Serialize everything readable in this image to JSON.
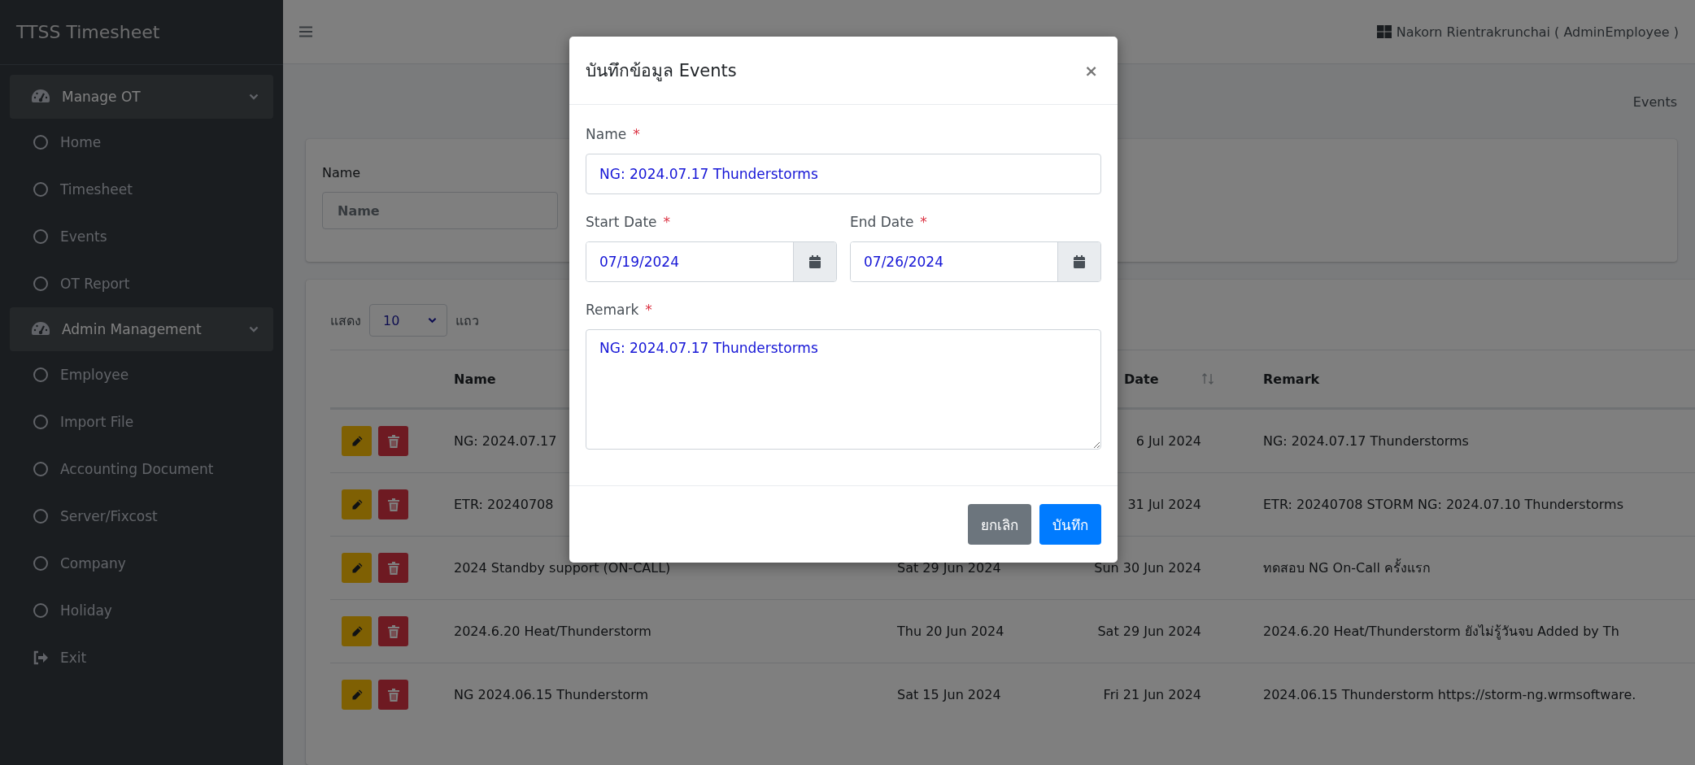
{
  "sidebar": {
    "brand": "TTSS Timesheet",
    "groups": [
      {
        "label": "Manage OT",
        "expanded": true,
        "items": [
          {
            "label": "Home",
            "kind": "circle"
          },
          {
            "label": "Timesheet",
            "kind": "circle"
          },
          {
            "label": "Events",
            "kind": "circle"
          },
          {
            "label": "OT Report",
            "kind": "circle"
          }
        ]
      },
      {
        "label": "Admin Management",
        "expanded": true,
        "items": [
          {
            "label": "Employee",
            "kind": "circle"
          },
          {
            "label": "Import File",
            "kind": "circle"
          },
          {
            "label": "Accounting Document",
            "kind": "circle"
          },
          {
            "label": "Server/Fixcost",
            "kind": "circle"
          },
          {
            "label": "Company",
            "kind": "circle"
          },
          {
            "label": "Holiday",
            "kind": "circle"
          },
          {
            "label": "Exit",
            "kind": "exit"
          }
        ]
      }
    ]
  },
  "topbar": {
    "user": "Nakorn Rientrakrunchai ( AdminEmployee )"
  },
  "breadcrumb": "Events",
  "filter": {
    "label": "Name",
    "placeholder": "Name"
  },
  "table": {
    "length": {
      "prefix": "แสดง",
      "value": "10",
      "suffix": "แถว"
    },
    "columns": [
      {
        "label": "Name"
      },
      {
        "label": "Date",
        "sortable": true
      },
      {
        "label": "Remark"
      }
    ],
    "rows": [
      {
        "name": "NG: 2024.07.17",
        "end": "6 Jul 2024",
        "remark": "NG: 2024.07.17 Thunderstorms"
      },
      {
        "name": "ETR: 20240708",
        "end": "31 Jul 2024",
        "remark": "ETR: 20240708 STORM NG: 2024.07.10 Thunderstorms"
      },
      {
        "name": "2024 Standby support (ON-CALL)",
        "start": "Sat 29 Jun 2024",
        "end": "Sun 30 Jun 2024",
        "remark": "ทดสอบ NG On-Call ครั้งแรก"
      },
      {
        "name": "2024.6.20 Heat/Thunderstorm",
        "start": "Thu 20 Jun 2024",
        "end": "Sat 29 Jun 2024",
        "remark": "2024.6.20 Heat/Thunderstorm ยังไม่รู้วันจบ Added by Th"
      },
      {
        "name": "NG 2024.06.15 Thunderstorm",
        "start": "Sat 15 Jun 2024",
        "end": "Fri 21 Jun 2024",
        "remark": "2024.06.15 Thunderstorm https://storm-ng.wrmsoftware."
      }
    ]
  },
  "modal": {
    "title": "บันทึกข้อมูล Events",
    "close": "×",
    "fields": [
      {
        "label": "Name",
        "required_mark": "*",
        "kind": "text",
        "value": "NG: 2024.07.17 Thunderstorms"
      },
      {
        "label": "Start Date",
        "required_mark": "*",
        "kind": "date",
        "value": "07/19/2024"
      },
      {
        "label": "End Date",
        "required_mark": "*",
        "kind": "date",
        "value": "07/26/2024"
      },
      {
        "label": "Remark",
        "required_mark": "*",
        "kind": "textarea",
        "value": "NG: 2024.07.17 Thunderstorms"
      }
    ],
    "buttons": [
      {
        "label": "ยกเลิก",
        "kind": "secondary"
      },
      {
        "label": "บันทึก",
        "kind": "primary"
      }
    ]
  }
}
